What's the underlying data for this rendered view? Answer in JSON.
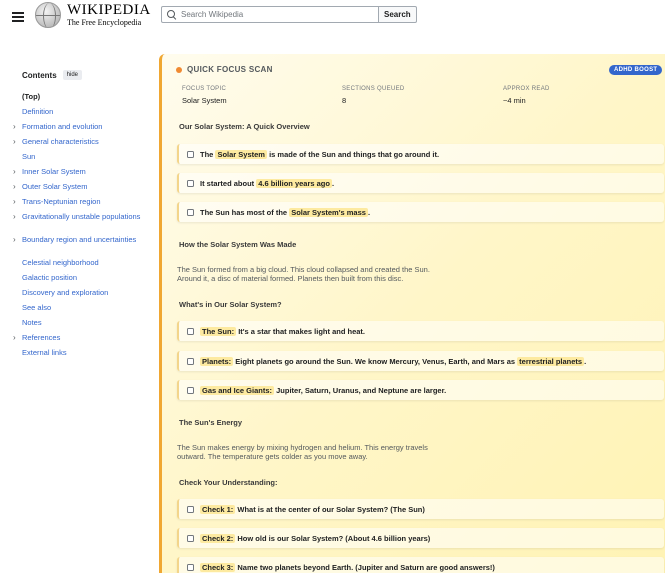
{
  "header": {
    "logo_title": "WIKIPEDIA",
    "logo_subtitle": "The Free Encyclopedia",
    "search_placeholder": "Search Wikipedia",
    "search_button": "Search"
  },
  "toc": {
    "title": "Contents",
    "hide_label": "hide",
    "items": [
      {
        "label": "(Top)",
        "expandable": false
      },
      {
        "label": "Definition",
        "expandable": false
      },
      {
        "label": "Formation and evolution",
        "expandable": true
      },
      {
        "label": "General characteristics",
        "expandable": true
      },
      {
        "label": "Sun",
        "expandable": false
      },
      {
        "label": "Inner Solar System",
        "expandable": true
      },
      {
        "label": "Outer Solar System",
        "expandable": true
      },
      {
        "label": "Trans-Neptunian region",
        "expandable": true
      },
      {
        "label": "Gravitationally unstable populations",
        "expandable": true
      },
      {
        "label": "Boundary region and uncertainties",
        "expandable": true
      },
      {
        "label": "Celestial neighborhood",
        "expandable": false
      },
      {
        "label": "Galactic position",
        "expandable": false
      },
      {
        "label": "Discovery and exploration",
        "expandable": false
      },
      {
        "label": "See also",
        "expandable": false
      },
      {
        "label": "Notes",
        "expandable": false
      },
      {
        "label": "References",
        "expandable": true
      },
      {
        "label": "External links",
        "expandable": false
      }
    ]
  },
  "scan": {
    "title": "QUICK FOCUS SCAN",
    "badge": "ADHD BOOST",
    "meta": [
      {
        "label": "FOCUS TOPIC",
        "value": "Solar System"
      },
      {
        "label": "SECTIONS QUEUED",
        "value": "8"
      },
      {
        "label": "APPROX READ",
        "value": "~4 min"
      }
    ],
    "sections": {
      "overview": "Our Solar System: A Quick Overview",
      "made": "How the Solar System Was Made",
      "whats_in": "What's in Our Solar System?",
      "energy": "The Sun's Energy",
      "check": "Check Your Understanding:"
    },
    "overview_items": [
      {
        "pre": "The",
        "hl": "Solar System",
        "post": "is made of the Sun and things that go around it."
      },
      {
        "pre": "It started about",
        "hl": "4.6 billion years ago",
        "post": "."
      },
      {
        "pre": "The Sun has most of the",
        "hl": "Solar System's mass",
        "post": "."
      }
    ],
    "made_text": "The Sun formed from a big cloud. This cloud collapsed and created the Sun. Around it, a disc of material formed. Planets then built from this disc.",
    "whats_in_items": [
      {
        "label": "The Sun:",
        "text": "It's a star that makes light and heat.",
        "hl": "",
        "post": ""
      },
      {
        "label": "Planets:",
        "text": "Eight planets go around the Sun. We know Mercury, Venus, Earth, and Mars as",
        "hl": "terrestrial planets",
        "post": "."
      },
      {
        "label": "Gas and Ice Giants:",
        "text": "Jupiter, Saturn, Uranus, and Neptune are larger.",
        "hl": "",
        "post": ""
      }
    ],
    "energy_text": "The Sun makes energy by mixing hydrogen and helium. This energy travels outward. The temperature gets colder as you move away.",
    "checks": [
      {
        "label": "Check 1:",
        "text": "What is at the center of our Solar System? (The Sun)"
      },
      {
        "label": "Check 2:",
        "text": "How old is our Solar System? (About 4.6 billion years)"
      },
      {
        "label": "Check 3:",
        "text": "Name two planets beyond Earth. (Jupiter and Saturn are good answers!)"
      }
    ]
  }
}
